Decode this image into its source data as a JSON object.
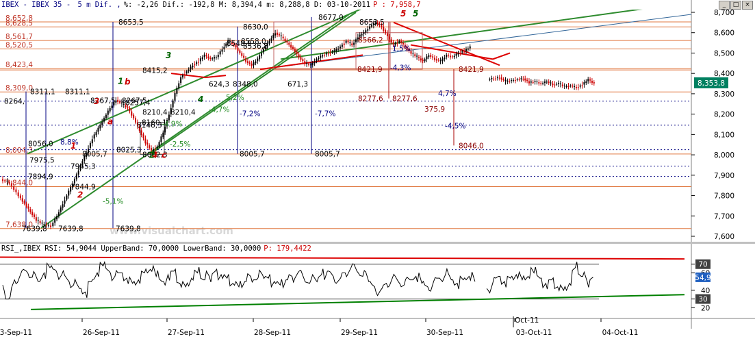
{
  "window": {
    "header_segments": [
      {
        "text": "IBEX - IBEX 35 - ",
        "color": "#000080"
      },
      {
        "text": "5 m Dif. ,",
        "color": "#000080"
      },
      {
        "text": "%: -2,26 Dif.: -192,8 M: 8,394,4 m: 8,288,8 D: 03-10-2011",
        "color": "#000000"
      },
      {
        "text": "P : 7,958,7",
        "color": "#cc0000"
      }
    ],
    "buttons": [
      "_",
      "□",
      "×"
    ]
  },
  "price_axis": {
    "ticks": [
      "8,700",
      "8,600",
      "8,500",
      "8,400",
      "8,300",
      "8,200",
      "8,100",
      "8,000",
      "7,900",
      "7,800",
      "7,700",
      "7,600"
    ],
    "last_price_label": "8,353,8",
    "ymin": 7600,
    "ymax": 8700
  },
  "fib_levels": [
    "8,652,8",
    "8,628,5",
    "8,561,7",
    "8,520,5",
    "8,423,4",
    "8,309,0",
    "8,004,3",
    "7,844,0",
    "7,638,0"
  ],
  "level_labels": [
    "8653,5",
    "8630,0",
    "8677,0",
    "8653,5",
    "8558,0",
    "8415,2",
    "8311,1",
    "8311,1",
    "8267,5",
    "8267,5",
    "8257,4",
    "8210,4",
    "8210,4",
    "8146,3",
    "8160,1",
    "8056,0",
    "8005,7",
    "8025,3",
    "8002,3",
    "8005,7",
    "8005,7",
    "7975,5",
    "7945,3",
    "7894,9",
    "7844,9",
    "7639,8",
    "7639,8",
    "7639,8",
    "8566,2",
    "8421,9",
    "8421,9",
    "8277,6",
    "8277,6",
    "8046,0",
    "8264,",
    "8548,9",
    "8536,8",
    "8348,0",
    "624,3",
    "671,3",
    "375,9"
  ],
  "percent_labels": [
    "8,8%",
    "-5,1%",
    "-2,5%",
    "-4,9%",
    "-7,2%",
    "-7,7%",
    "-4,3%",
    "4,7%",
    "-4,5%",
    "1,5%",
    "5,2%",
    "-4,7%"
  ],
  "wave_labels": [
    "1",
    "2",
    "3",
    "4",
    "5",
    "1",
    "2",
    "3",
    "4",
    "5",
    "a",
    "b",
    "c"
  ],
  "watermark": "www.visualchart.com",
  "rsi": {
    "header_segments": [
      {
        "text": "RSI_,IBEX RSI: 54,9044 UpperBand: 70,0000 LowerBand: 30,0000",
        "color": "#000000"
      },
      {
        "text": "P: 179,4422",
        "color": "#cc0000"
      }
    ],
    "ticks": [
      "70",
      "60",
      "40",
      "30",
      "20"
    ],
    "upper_badge": "70",
    "value_badge": "54,9",
    "lower_badge": "30",
    "upper_band": 70,
    "lower_band": 30
  },
  "time_axis": {
    "labels": [
      "23-Sep-11",
      "26-Sep-11",
      "27-Sep-11",
      "28-Sep-11",
      "29-Sep-11",
      "30-Sep-11",
      "03-Oct-11",
      "04-Oct-11"
    ],
    "session_marker": "Oct-11"
  },
  "colors": {
    "up_candle": "#000000",
    "down_candle": "#cc0000",
    "fib_line": "#e07840",
    "channel_green": "#2e8b2e",
    "trend_red": "#dd0000",
    "measure_blue": "#000080",
    "rsi_line": "#000000",
    "rsi_upper": "#dd0000",
    "rsi_lower": "#008000",
    "last_price_bg": "#008060"
  },
  "chart_data": {
    "type": "candlestick",
    "title": "IBEX - IBEX 35 - 5 m Dif.",
    "ylim": [
      7600,
      8700
    ],
    "price_path": [
      [
        0,
        7880
      ],
      [
        3,
        7860
      ],
      [
        6,
        7800
      ],
      [
        8,
        7760
      ],
      [
        10,
        7720
      ],
      [
        12,
        7680
      ],
      [
        14,
        7660
      ],
      [
        17,
        7650
      ],
      [
        19,
        7700
      ],
      [
        21,
        7760
      ],
      [
        23,
        7820
      ],
      [
        25,
        7880
      ],
      [
        27,
        7950
      ],
      [
        29,
        8010
      ],
      [
        31,
        8080
      ],
      [
        33,
        8130
      ],
      [
        35,
        8180
      ],
      [
        37,
        8230
      ],
      [
        39,
        8270
      ],
      [
        41,
        8250
      ],
      [
        43,
        8230
      ],
      [
        45,
        8180
      ],
      [
        47,
        8120
      ],
      [
        49,
        8060
      ],
      [
        51,
        8020
      ],
      [
        53,
        8040
      ],
      [
        55,
        8110
      ],
      [
        57,
        8200
      ],
      [
        59,
        8300
      ],
      [
        61,
        8380
      ],
      [
        63,
        8410
      ],
      [
        65,
        8440
      ],
      [
        67,
        8460
      ],
      [
        69,
        8490
      ],
      [
        71,
        8470
      ],
      [
        73,
        8480
      ],
      [
        75,
        8520
      ],
      [
        77,
        8560
      ],
      [
        79,
        8540
      ],
      [
        81,
        8500
      ],
      [
        83,
        8460
      ],
      [
        85,
        8440
      ],
      [
        87,
        8470
      ],
      [
        89,
        8520
      ],
      [
        91,
        8560
      ],
      [
        93,
        8600
      ],
      [
        95,
        8580
      ],
      [
        97,
        8550
      ],
      [
        99,
        8520
      ],
      [
        101,
        8480
      ],
      [
        103,
        8450
      ],
      [
        105,
        8440
      ],
      [
        107,
        8470
      ],
      [
        109,
        8490
      ],
      [
        111,
        8500
      ],
      [
        113,
        8510
      ],
      [
        115,
        8530
      ],
      [
        117,
        8560
      ],
      [
        119,
        8540
      ],
      [
        121,
        8580
      ],
      [
        123,
        8600
      ],
      [
        125,
        8630
      ],
      [
        127,
        8650
      ],
      [
        129,
        8630
      ],
      [
        131,
        8580
      ],
      [
        133,
        8540
      ],
      [
        135,
        8560
      ],
      [
        137,
        8530
      ],
      [
        139,
        8500
      ],
      [
        141,
        8480
      ],
      [
        143,
        8460
      ],
      [
        145,
        8490
      ],
      [
        147,
        8470
      ],
      [
        149,
        8460
      ],
      [
        151,
        8490
      ],
      [
        153,
        8480
      ],
      [
        155,
        8500
      ],
      [
        157,
        8510
      ],
      [
        159,
        8530
      ],
      [
        165,
        8370
      ],
      [
        167,
        8375
      ],
      [
        169,
        8380
      ],
      [
        171,
        8360
      ],
      [
        173,
        8365
      ],
      [
        175,
        8370
      ],
      [
        177,
        8375
      ],
      [
        179,
        8355
      ],
      [
        181,
        8360
      ],
      [
        183,
        8350
      ],
      [
        185,
        8360
      ],
      [
        187,
        8345
      ],
      [
        189,
        8350
      ],
      [
        191,
        8335
      ],
      [
        193,
        8340
      ],
      [
        195,
        8330
      ],
      [
        197,
        8345
      ],
      [
        199,
        8370
      ],
      [
        201,
        8350
      ]
    ],
    "rsi_path": [
      [
        0,
        46
      ],
      [
        2,
        30
      ],
      [
        4,
        52
      ],
      [
        6,
        58
      ],
      [
        8,
        62
      ],
      [
        10,
        55
      ],
      [
        12,
        50
      ],
      [
        14,
        60
      ],
      [
        16,
        66
      ],
      [
        18,
        63
      ],
      [
        20,
        58
      ],
      [
        22,
        52
      ],
      [
        24,
        46
      ],
      [
        26,
        42
      ],
      [
        28,
        38
      ],
      [
        30,
        50
      ],
      [
        32,
        60
      ],
      [
        34,
        68
      ],
      [
        36,
        62
      ],
      [
        38,
        56
      ],
      [
        40,
        60
      ],
      [
        42,
        54
      ],
      [
        44,
        48
      ],
      [
        46,
        52
      ],
      [
        48,
        60
      ],
      [
        50,
        64
      ],
      [
        52,
        56
      ],
      [
        54,
        50
      ],
      [
        56,
        58
      ],
      [
        58,
        62
      ],
      [
        60,
        48
      ],
      [
        62,
        44
      ],
      [
        64,
        54
      ],
      [
        66,
        60
      ],
      [
        68,
        52
      ],
      [
        70,
        56
      ],
      [
        72,
        62
      ],
      [
        74,
        58
      ],
      [
        76,
        54
      ],
      [
        78,
        48
      ],
      [
        80,
        44
      ],
      [
        82,
        50
      ],
      [
        84,
        56
      ],
      [
        86,
        52
      ],
      [
        88,
        58
      ],
      [
        90,
        54
      ],
      [
        92,
        50
      ],
      [
        94,
        46
      ],
      [
        96,
        52
      ],
      [
        98,
        56
      ],
      [
        100,
        60
      ],
      [
        102,
        54
      ],
      [
        104,
        48
      ],
      [
        106,
        52
      ],
      [
        108,
        58
      ],
      [
        110,
        62
      ],
      [
        112,
        56
      ],
      [
        114,
        52
      ],
      [
        116,
        60
      ],
      [
        118,
        66
      ],
      [
        120,
        62
      ],
      [
        122,
        56
      ],
      [
        124,
        50
      ],
      [
        126,
        44
      ],
      [
        128,
        40
      ],
      [
        130,
        48
      ],
      [
        132,
        54
      ],
      [
        134,
        50
      ],
      [
        136,
        46
      ],
      [
        138,
        52
      ],
      [
        140,
        56
      ],
      [
        142,
        48
      ],
      [
        144,
        44
      ],
      [
        146,
        50
      ],
      [
        148,
        54
      ],
      [
        150,
        58
      ],
      [
        152,
        52
      ],
      [
        154,
        48
      ],
      [
        156,
        52
      ],
      [
        158,
        56
      ],
      [
        160,
        50
      ],
      [
        164,
        42
      ],
      [
        166,
        48
      ],
      [
        168,
        56
      ],
      [
        170,
        50
      ],
      [
        172,
        54
      ],
      [
        174,
        58
      ],
      [
        176,
        52
      ],
      [
        178,
        56
      ],
      [
        180,
        60
      ],
      [
        182,
        54
      ],
      [
        184,
        48
      ],
      [
        186,
        52
      ],
      [
        188,
        44
      ],
      [
        190,
        40
      ],
      [
        192,
        48
      ],
      [
        194,
        66
      ],
      [
        196,
        56
      ],
      [
        198,
        50
      ],
      [
        200,
        55
      ]
    ],
    "x_index_range": [
      0,
      202
    ]
  }
}
